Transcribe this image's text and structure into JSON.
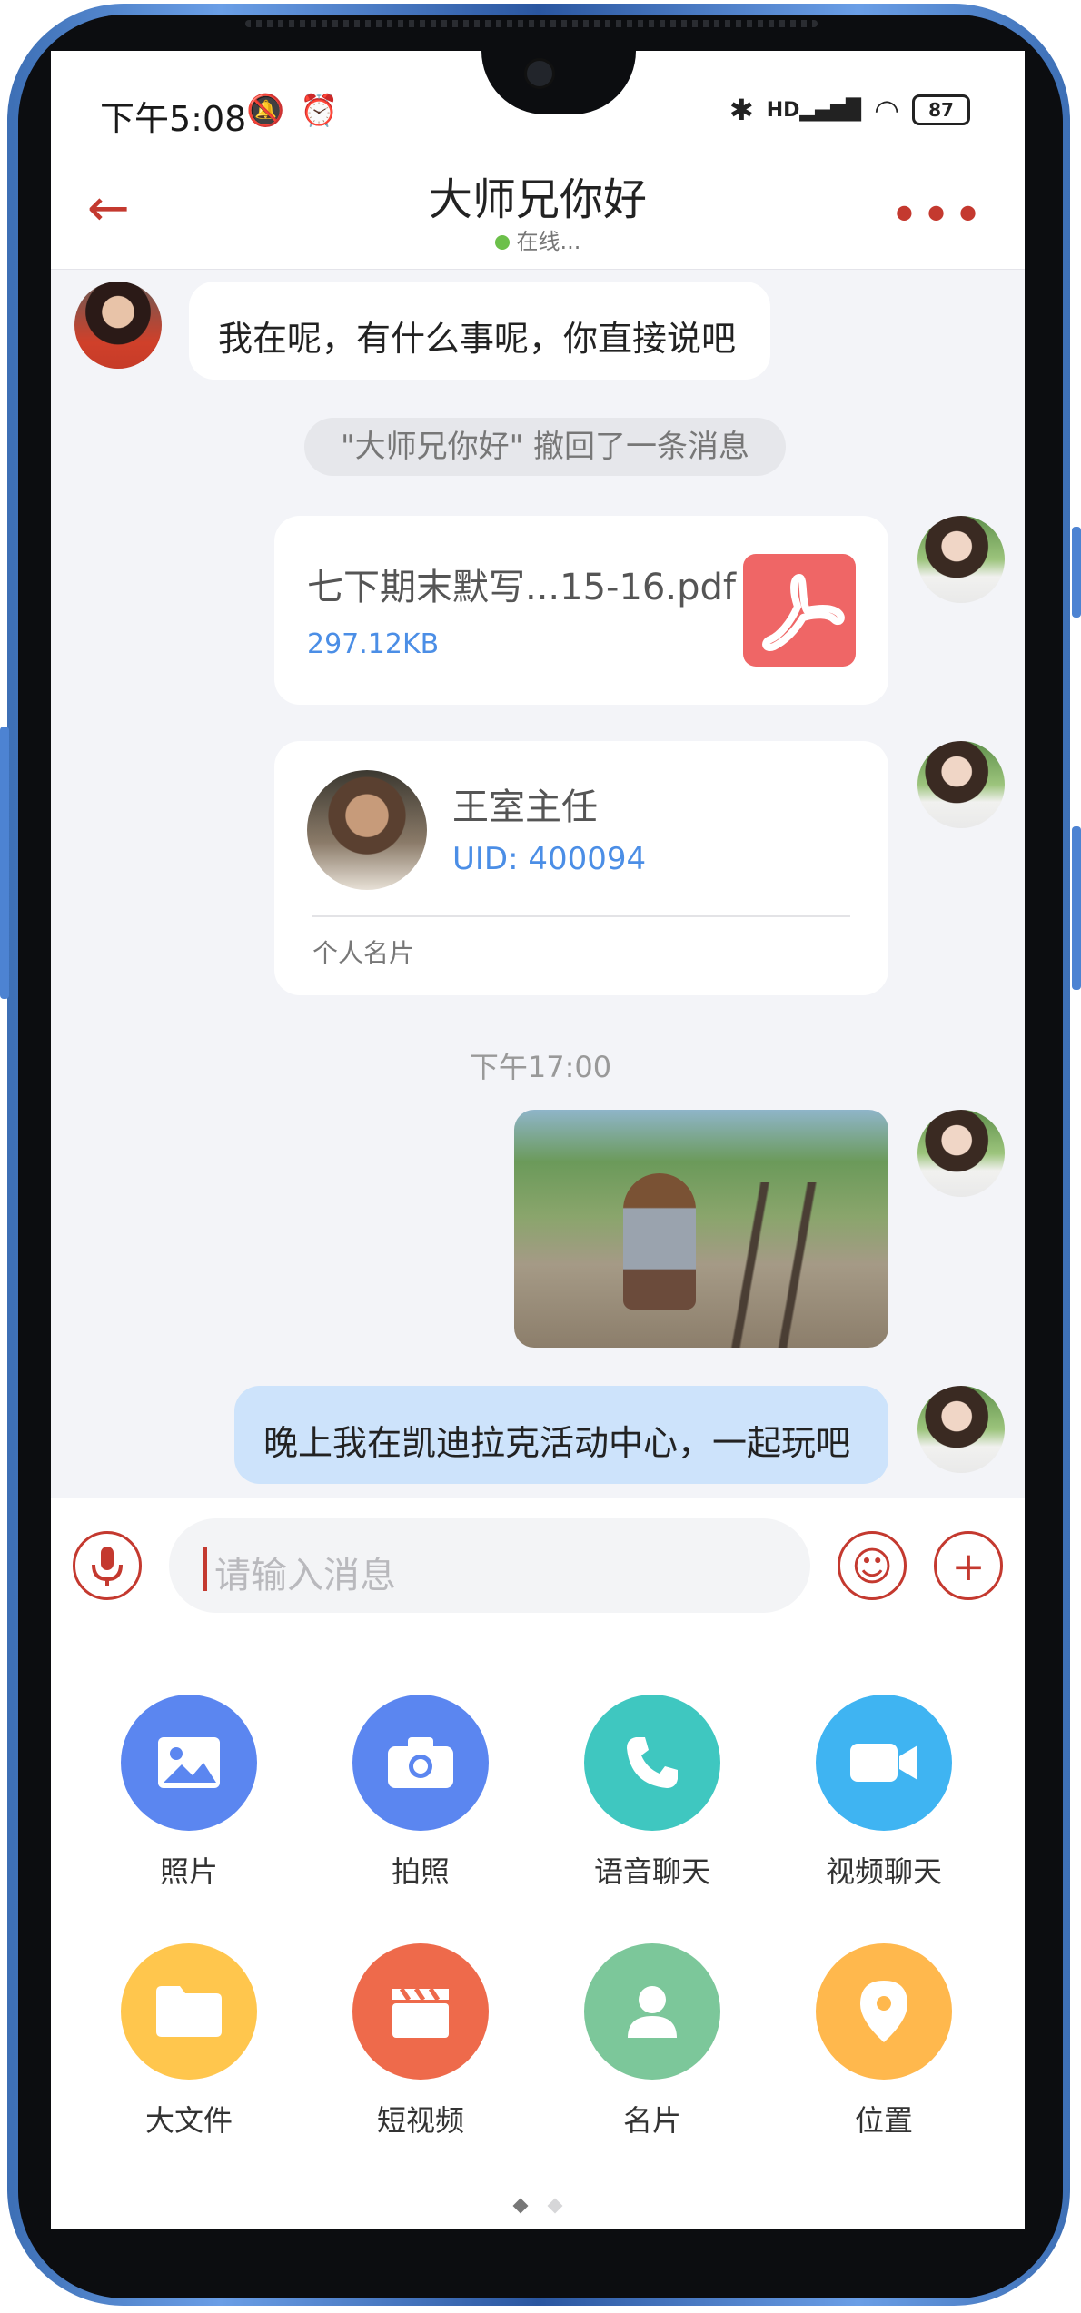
{
  "status_bar": {
    "time": "下午5:08",
    "icons": [
      "mute-icon",
      "alarm-icon",
      "bluetooth-icon",
      "hd-signal-icon",
      "wifi-icon"
    ],
    "hd_label": "HD",
    "battery": "87"
  },
  "header": {
    "title": "大师兄你好",
    "status": "在线..."
  },
  "messages": {
    "incoming_text": "我在呢，有什么事呢，你直接说吧",
    "recall_notice": "\"大师兄你好\" 撤回了一条消息",
    "file": {
      "name": "七下期末默写...15-16.pdf",
      "size": "297.12KB"
    },
    "contact_card": {
      "name": "王室主任",
      "uid": "UID: 400094",
      "label": "个人名片"
    },
    "timestamp": "下午17:00",
    "outgoing_text": "晚上我在凯迪拉克活动中心，一起玩吧"
  },
  "input": {
    "placeholder": "请输入消息"
  },
  "tools": [
    {
      "label": "照片",
      "icon": "photo-icon",
      "color": "#5b86f0"
    },
    {
      "label": "拍照",
      "icon": "camera-icon",
      "color": "#5b86f0"
    },
    {
      "label": "语音聊天",
      "icon": "phone-icon",
      "color": "#3fc7c0"
    },
    {
      "label": "视频聊天",
      "icon": "video-icon",
      "color": "#3fb4f2"
    },
    {
      "label": "大文件",
      "icon": "folder-icon",
      "color": "#ffc64d"
    },
    {
      "label": "短视频",
      "icon": "clapper-icon",
      "color": "#ee6a4b"
    },
    {
      "label": "名片",
      "icon": "person-icon",
      "color": "#7cc79a"
    },
    {
      "label": "位置",
      "icon": "location-icon",
      "color": "#ffb84d"
    }
  ],
  "colors": {
    "accent": "#c4392f",
    "link": "#4b8ee6",
    "outgoing_bubble": "#cde3fb",
    "online": "#6cc04a"
  }
}
